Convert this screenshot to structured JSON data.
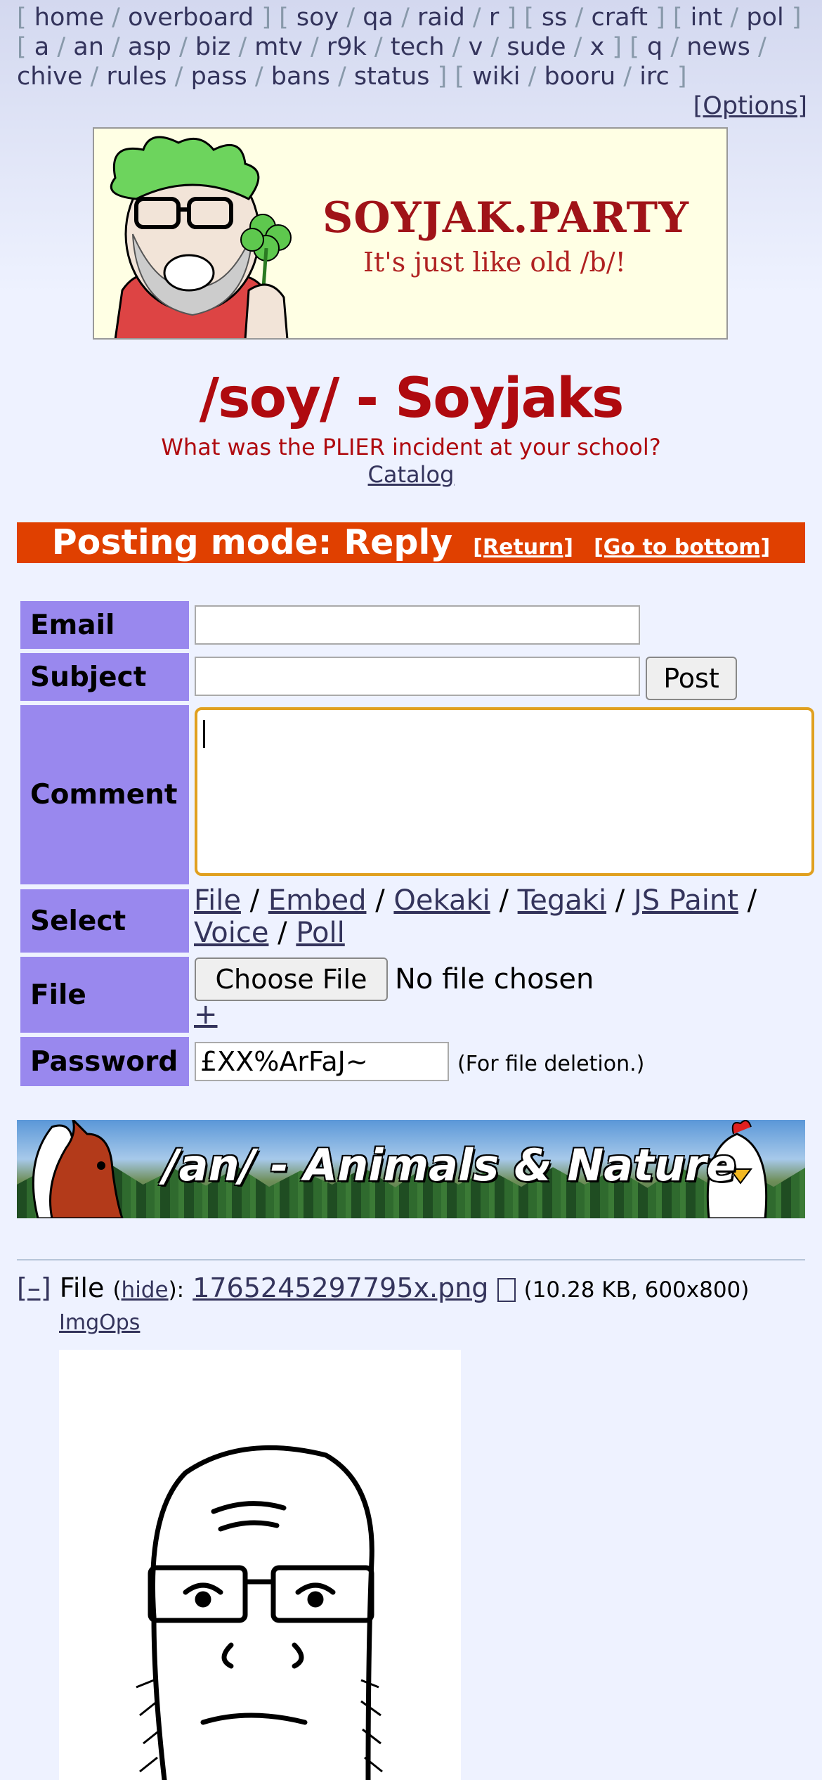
{
  "nav": {
    "groups": [
      [
        "home",
        "overboard"
      ],
      [
        "soy",
        "qa",
        "raid",
        "r"
      ],
      [
        "ss",
        "craft"
      ],
      [
        "int",
        "pol"
      ],
      [
        "a",
        "an",
        "asp",
        "biz",
        "mtv",
        "r9k",
        "tech",
        "v",
        "sude",
        "x"
      ],
      [
        "q",
        "news",
        "chive",
        "rules",
        "pass",
        "bans",
        "status"
      ],
      [
        "wiki",
        "booru",
        "irc"
      ]
    ],
    "options": "[Options]"
  },
  "banner": {
    "title": "SOYJAK.PARTY",
    "subtitle": "It's just like old /b/!"
  },
  "board": {
    "title": "/soy/ - Soyjaks",
    "subtitle": "What was the PLIER incident at your school?",
    "catalog": "Catalog"
  },
  "posting_mode": {
    "label": "Posting mode: Reply",
    "return": "[Return]",
    "bottom": "[Go to bottom]"
  },
  "form": {
    "email_label": "Email",
    "subject_label": "Subject",
    "comment_label": "Comment",
    "select_label": "Select",
    "file_label": "File",
    "password_label": "Password",
    "post_button": "Post",
    "email_value": "",
    "subject_value": "",
    "select_options": [
      "File",
      "Embed",
      "Oekaki",
      "Tegaki",
      "JS Paint",
      "Voice",
      "Poll"
    ],
    "choose_file": "Choose File",
    "no_file": "No file chosen",
    "add_file": "+",
    "password_value": "£XX%ArFaJ~",
    "password_note": "(For file deletion.)"
  },
  "ad": {
    "text": "/an/ - Animals & Nature"
  },
  "thread": {
    "collapse": "[–]",
    "file_label": "File",
    "hide": "hide",
    "filename": "1765245297795x.png",
    "file_meta": "(10.28 KB, 600x800)",
    "imgops": "ImgOps"
  },
  "colors": {
    "title_red": "#af0a0f",
    "label_purple": "#9988ee",
    "postmode_orange": "#e04000",
    "link": "#34345c"
  }
}
